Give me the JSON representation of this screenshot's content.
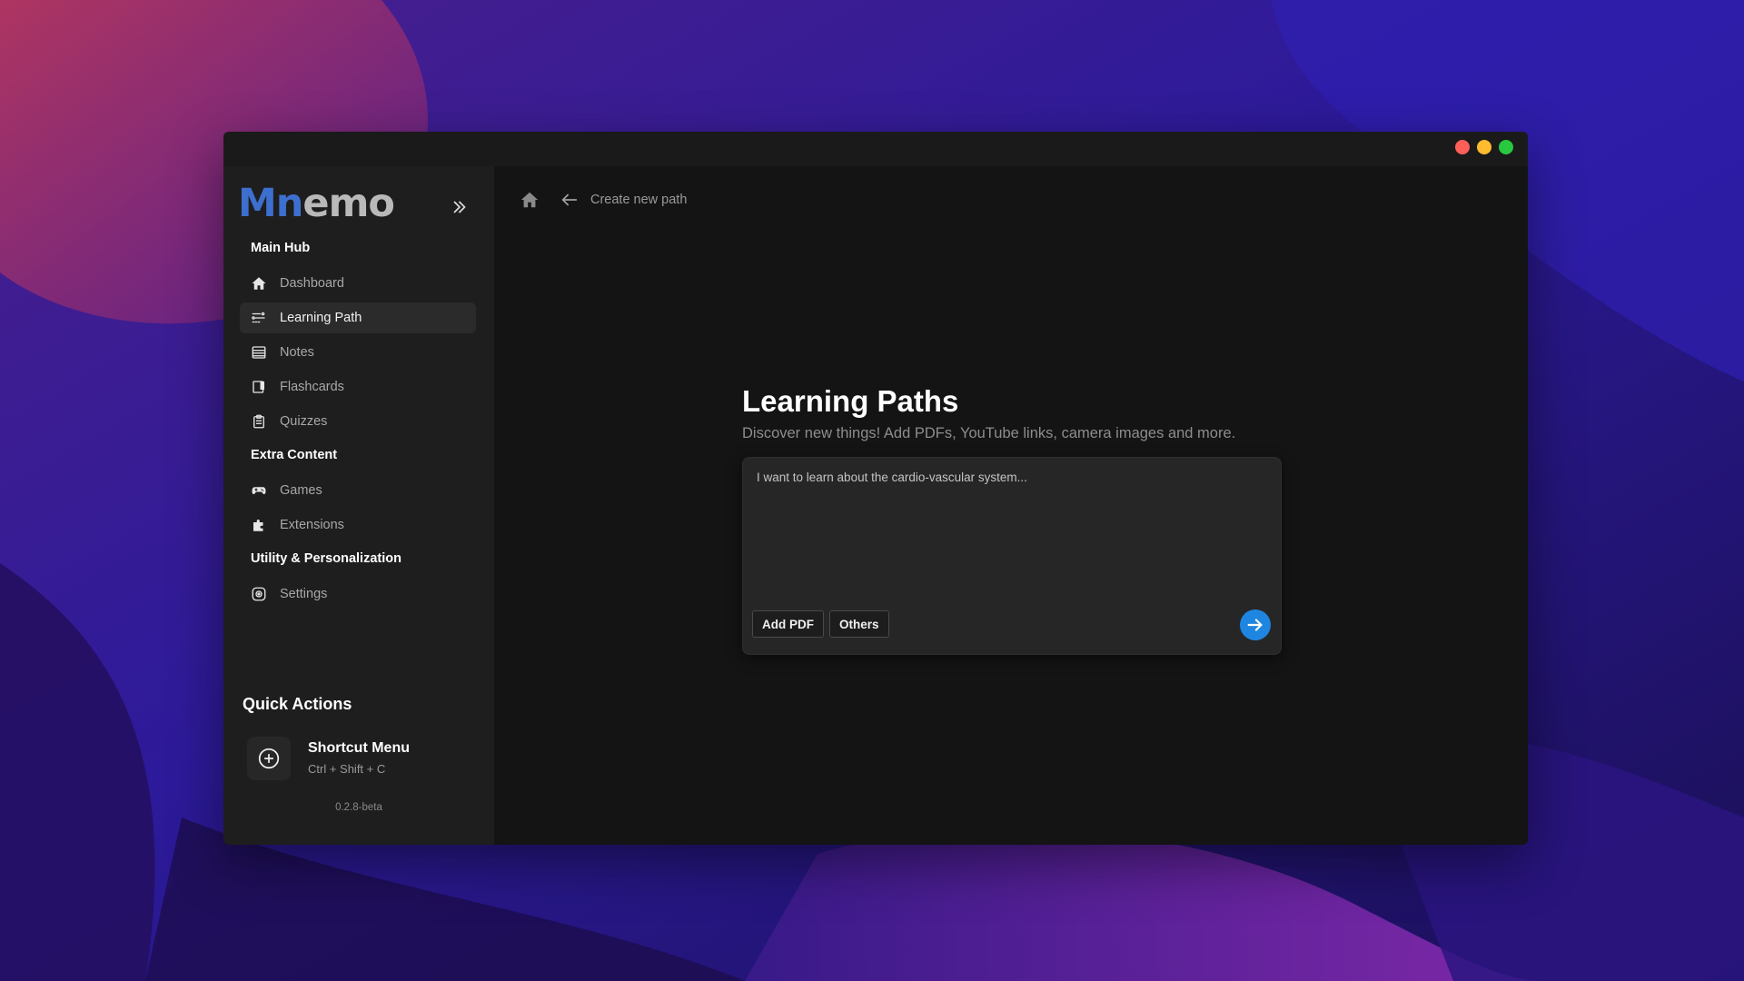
{
  "window": {
    "traffic_lights": [
      {
        "name": "close",
        "color": "#fe5f57"
      },
      {
        "name": "minimize",
        "color": "#febc2e"
      },
      {
        "name": "maximize",
        "color": "#28c840"
      }
    ]
  },
  "sidebar": {
    "brand_part1": "Mn",
    "brand_part2": "emo",
    "collapse_icon": "chevrons-right-icon",
    "sections": [
      {
        "title": "Main Hub"
      },
      {
        "title": "Extra Content"
      },
      {
        "title": "Utility & Personalization"
      }
    ],
    "items": [
      {
        "label": "Dashboard",
        "icon": "home-icon",
        "active": false
      },
      {
        "label": "Learning Path",
        "icon": "path-icon",
        "active": true
      },
      {
        "label": "Notes",
        "icon": "notes-icon",
        "active": false
      },
      {
        "label": "Flashcards",
        "icon": "flashcards-icon",
        "active": false
      },
      {
        "label": "Quizzes",
        "icon": "clipboard-icon",
        "active": false
      },
      {
        "label": "Games",
        "icon": "gamepad-icon",
        "active": false
      },
      {
        "label": "Extensions",
        "icon": "puzzle-icon",
        "active": false
      },
      {
        "label": "Settings",
        "icon": "settings-icon",
        "active": false
      }
    ],
    "quick_actions": {
      "title": "Quick Actions",
      "shortcut": {
        "icon": "plus-circle-icon",
        "title": "Shortcut Menu",
        "keys": "Ctrl + Shift + C"
      }
    },
    "version": "0.2.8-beta"
  },
  "breadcrumb": {
    "home_icon": "home-icon",
    "back_icon": "arrow-left-icon",
    "label": "Create new path"
  },
  "main": {
    "title": "Learning Paths",
    "subtitle": "Discover new things! Add PDFs, YouTube links, camera images and more.",
    "prompt_placeholder": "I want to learn about the cardio-vascular system...",
    "add_pdf_label": "Add PDF",
    "others_label": "Others",
    "send_icon": "arrow-right-icon",
    "accent_color": "#1e86e0"
  }
}
